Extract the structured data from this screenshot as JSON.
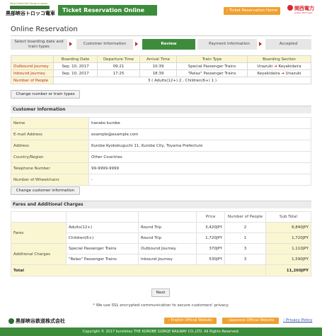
{
  "header": {
    "logo_tagline": "Most Protected Gorge in Japan",
    "logo_text": "黒部峡谷トロッコ電車",
    "title": "Ticket Reservation Online",
    "home_button": "Ticket Reservation Home",
    "partner_logo": "関西電力",
    "partner_tagline": "power with heart"
  },
  "page_title": "Online Reservation",
  "steps": [
    {
      "label": "Select boarding date and train types",
      "active": false
    },
    {
      "label": "Customer Information",
      "active": false
    },
    {
      "label": "Review",
      "active": true
    },
    {
      "label": "Payment Information",
      "active": false
    },
    {
      "label": "Accepted",
      "active": false
    }
  ],
  "trip_table": {
    "headers": [
      "",
      "Boarding Date",
      "Departure Time",
      "Arrival Time",
      "Train Type",
      "Boarding Section"
    ],
    "rows": [
      {
        "label": "Outbound Journey",
        "date": "Sep. 10, 2017",
        "departure": "09:21",
        "arrival": "10:39",
        "train": "Special Passenger Trains",
        "from": "Unazuki",
        "to": "Keyakidaira"
      },
      {
        "label": "Inbound Journey",
        "date": "Sep. 10, 2017",
        "departure": "17:25",
        "arrival": "18:39",
        "train": "\"Relax\" Passenger Trains",
        "from": "Keyakidaira",
        "to": "Unazuki"
      }
    ],
    "people_label": "Number of People",
    "people_value": "3 ( Adults(12+) 2 , Children(6+) 1 )"
  },
  "change_number_button": "Change number or train types",
  "customer_section_title": "Customer Information",
  "customer_info": [
    {
      "key": "Name",
      "value": "hanako kurobe"
    },
    {
      "key": "E-mail Address",
      "value": "example@example.com"
    },
    {
      "key": "Address",
      "value": "Kurobe Kyokokuguchi 11, Kurobe City, Toyama Prefecture"
    },
    {
      "key": "Country/Region",
      "value": "Other Countries"
    },
    {
      "key": "Telephone Number",
      "value": "99-9999-9999"
    },
    {
      "key": "Number of Wheelchairs",
      "value": "-"
    }
  ],
  "change_customer_button": "Change customer information",
  "fares_section_title": "Fares and Additional Charges",
  "fares_table": {
    "headers": [
      "Price",
      "Number of People",
      "Sub Total"
    ],
    "fares_label": "Fares",
    "fares_rows": [
      {
        "item": "Adults(12+)",
        "type": "Round Trip",
        "price": "3,420JPY",
        "people": "2",
        "subtotal": "6,840JPY"
      },
      {
        "item": "Children(6+)",
        "type": "Round Trip",
        "price": "1,720JPY",
        "people": "1",
        "subtotal": "1,720JPY"
      }
    ],
    "additional_label": "Additional Charges",
    "additional_rows": [
      {
        "item": "Special Passenger Trains",
        "type": "Outbound Journey",
        "price": "370JPY",
        "people": "3",
        "subtotal": "1,110JPY"
      },
      {
        "item": "\"Relax\" Passenger Trains",
        "type": "Inbound Journey",
        "price": "530JPY",
        "people": "3",
        "subtotal": "1,590JPY"
      }
    ],
    "total_label": "Total",
    "total_value": "11,260JPY"
  },
  "next_button": "Next",
  "ssl_star": "*",
  "ssl_notice": "We use SSL encrypted communication to secure customers' privacy.",
  "footer": {
    "company": "黒部峡谷鉄道株式会社",
    "english_site": "English Official Website",
    "japanese_site": "Japanese Official Website",
    "privacy": "Privacy Policy",
    "copyright": "Copyright © 2017 kurotetsu THE KUROBE GORGE RAILWAY CO.,LTD. All Rights Reserved."
  },
  "colors": {
    "brand_green": "#3c8c3c",
    "accent_orange": "#f0a030",
    "highlight_yellow": "#fbf6d2",
    "arrow_red": "#c0282a"
  }
}
